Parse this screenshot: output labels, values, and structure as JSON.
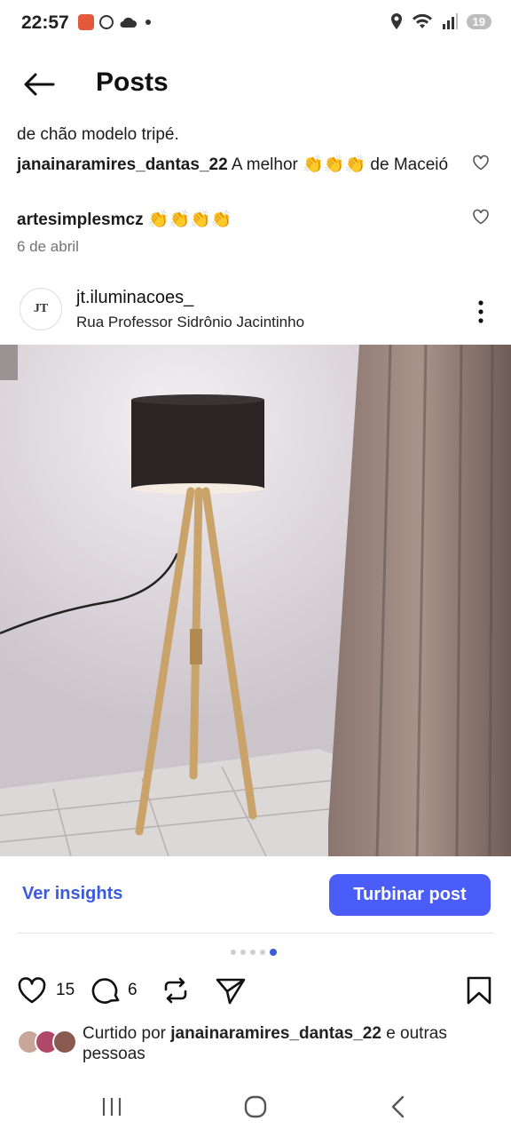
{
  "status_bar": {
    "time": "22:57",
    "battery": "19"
  },
  "header": {
    "title": "Posts"
  },
  "comments": {
    "caption_tail": "de chão modelo tripé.",
    "items": [
      {
        "username": "janainaramires_dantas_22",
        "text_before": " A melhor ",
        "emojis": "👏👏👏",
        "text_after": " de Maceió"
      },
      {
        "username": "artesimplesmcz",
        "text_before": " ",
        "emojis": "👏👏👏👏",
        "text_after": ""
      }
    ],
    "date": "6 de abril"
  },
  "post": {
    "username": "jt.iluminacoes_",
    "location": "Rua Professor Sidrônio Jacintinho",
    "avatar_text": "JT"
  },
  "insights": {
    "link": "Ver insights",
    "boost_button": "Turbinar post"
  },
  "carousel": {
    "total": 5,
    "active_index": 4
  },
  "actions": {
    "likes": "15",
    "comments": "6"
  },
  "liked_by": {
    "prefix": "Curtido por ",
    "user": "janainaramires_dantas_22",
    "suffix": " e outras pessoas"
  },
  "colors": {
    "accent": "#4a5df9",
    "link": "#3b5bdb"
  }
}
